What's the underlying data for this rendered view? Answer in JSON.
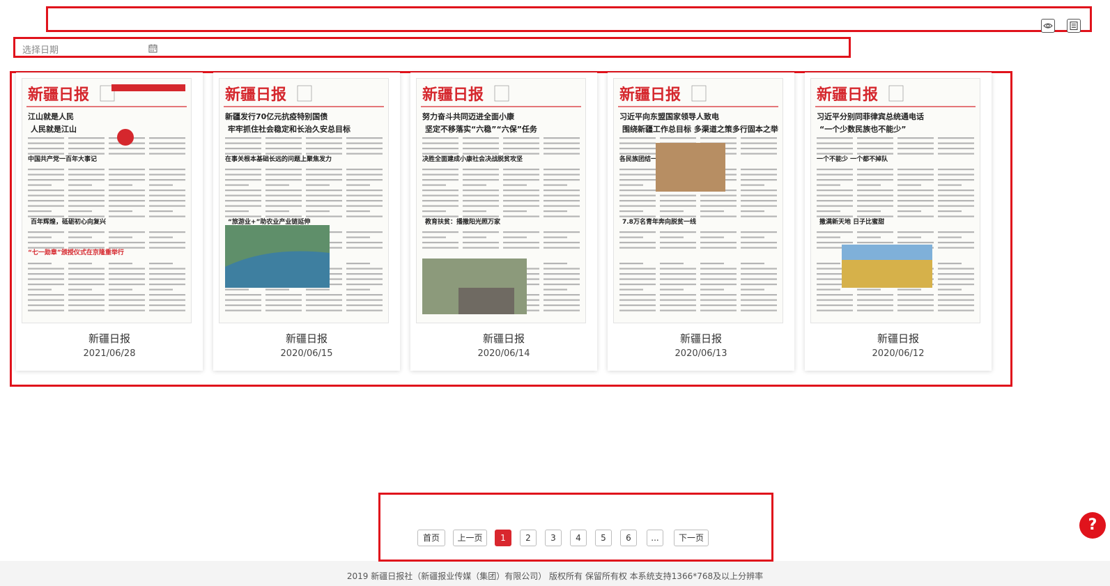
{
  "toolbar": {
    "view_icon": "eye-icon",
    "list_icon": "list-icon"
  },
  "date_filter": {
    "placeholder": "选择日期",
    "icon": "calendar-icon"
  },
  "thumb_brand": "新疆日报",
  "cards": [
    {
      "title": "新疆日报",
      "date": "2021/06/28",
      "headlines": [
        "江山就是人民",
        "人民就是江山",
        "中国共产党一百年大事记",
        "百年辉煌，砥砺初心向复兴",
        "“七一勋章”颁授仪式在京隆重举行"
      ]
    },
    {
      "title": "新疆日报",
      "date": "2020/06/15",
      "headlines": [
        "新疆发行70亿元抗疫特别国债",
        "牢牢抓住社会稳定和长治久安总目标",
        "在事关根本基础长远的问题上聚焦发力",
        "“旅游业+”助农业产业链延伸"
      ]
    },
    {
      "title": "新疆日报",
      "date": "2020/06/14",
      "headlines": [
        "努力奋斗共同迈进全面小康",
        "坚定不移落实“六稳”“六保”任务",
        "决胜全面建成小康社会决战脱贫攻坚",
        "教育扶贫：播撒阳光照万家"
      ]
    },
    {
      "title": "新疆日报",
      "date": "2020/06/13",
      "headlines": [
        "习近平向东盟国家领导人致电",
        "围绕新疆工作总目标 多渠道之策多行固本之举",
        "各民族团结一心",
        "7.8万名青年奔向脱贫一线"
      ]
    },
    {
      "title": "新疆日报",
      "date": "2020/06/12",
      "headlines": [
        "习近平分别同菲律宾总统通电话",
        "“一个少数民族也不能少”",
        "一个不能少 一个都不掉队",
        "撒满新天地 日子比蜜甜"
      ]
    }
  ],
  "pagination": {
    "first": "首页",
    "prev": "上一页",
    "pages": [
      "1",
      "2",
      "3",
      "4",
      "5",
      "6"
    ],
    "ellipsis": "...",
    "next": "下一页",
    "current": "1"
  },
  "help": {
    "label": "?"
  },
  "footer": {
    "text": "2019 新疆日报社（新疆报业传媒（集团）有限公司） 版权所有 保留所有权 本系统支持1366*768及以上分辨率"
  },
  "colors": {
    "accent": "#e0131c",
    "pager_active": "#d9272e",
    "masthead": "#d5272d"
  }
}
